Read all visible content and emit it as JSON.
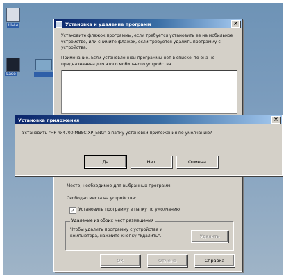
{
  "colors": {
    "titlebar_start": "#0a246a",
    "titlebar_end": "#a6caf0",
    "dialog_face": "#d4d0c8"
  },
  "desktop": {
    "icons": [
      {
        "label": "Lista",
        "glyph": "document-icon"
      },
      {
        "label": "",
        "glyph": "computer-icon"
      },
      {
        "label": "Lase",
        "glyph": "folder-icon"
      }
    ]
  },
  "main_dialog": {
    "title": "Установка и удаление программ",
    "intro_text": "Установите флажок программы, если требуется установить ее на мобильное устройство, или снимите флажок, если требуется удалить программу с устройства.",
    "note_text": "Примечание. Если установленной программы нет в списке, то она не предназначена для этого мобильного устройства.",
    "space_required_label": "Место, необходимое для выбранных программ:",
    "free_space_label": "Свободно места на устройстве:",
    "install_default_checkbox": {
      "label": "Установить программу в папку по умолчанию",
      "checked": true
    },
    "remove_group": {
      "title": "Удаление из обоих мест размещения",
      "text": "Чтобы удалить программу с устройства и компьютера, нажмите кнопку \"Удалить\".",
      "remove_button": "Удалить"
    },
    "buttons": {
      "ok": "ОК",
      "cancel": "Отмена",
      "help": "Справка"
    }
  },
  "confirm_dialog": {
    "title": "Установка приложения",
    "message": "Установить \"HP hx4700 MBSC XP_ENG\" в папку установки приложения по умолчанию?",
    "buttons": {
      "yes": "Да",
      "no": "Нет",
      "cancel": "Отмена"
    }
  }
}
